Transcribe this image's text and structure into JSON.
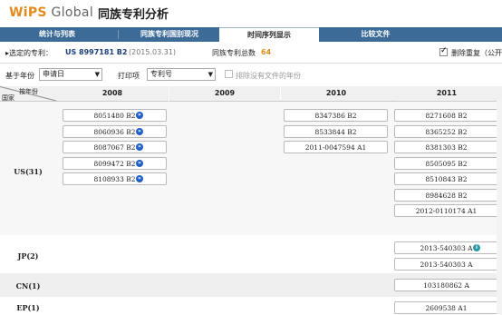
{
  "header": {
    "logo_prefix": "WiPS",
    "logo_suffix": " Global",
    "title": "同族专利分析"
  },
  "tabs": [
    {
      "label": "统计与列表"
    },
    {
      "label": "同族专利国别现况"
    },
    {
      "label": "时间序列显示"
    },
    {
      "label": "比较文件"
    }
  ],
  "active_tab": 2,
  "info": {
    "selected_label": "▸选定的专利：",
    "patent_number": "US 8997181 B2",
    "patent_date": "(2015.03.31)",
    "family_total_label": "同族专利总数",
    "family_total": "64",
    "dedupe_label": "删除重复（公开",
    "dedupe_checked": true
  },
  "filters": {
    "year_basis_label": "基于年份",
    "year_basis_value": "申请日",
    "print_label": "打印项",
    "print_value": "专利号",
    "exclude_label": "排除没有文件的年份"
  },
  "grid": {
    "corner_top": "按年份",
    "corner_bottom": "国家",
    "years": [
      "2008",
      "2009",
      "2010",
      "2011"
    ],
    "rows": [
      {
        "label": "US(31)",
        "cells": [
          [
            "8051480 B2",
            "8060936 B2",
            "8087067 B2",
            "8099472 B2",
            "8108933 B2"
          ],
          [],
          [
            "8347386 B2",
            "8533844 B2",
            "2011-0047594 A1"
          ],
          [
            "8271608 B2",
            "8365252 B2",
            "8381303 B2",
            "8505095 B2",
            "8510843 B2",
            "8984628 B2",
            "2012-0110174 A1"
          ]
        ]
      },
      {
        "label": "JP(2)",
        "cells": [
          [],
          [],
          [],
          [
            "2013-540303 A",
            "2013-540303 A"
          ]
        ]
      },
      {
        "label": "CN(1)",
        "cells": [
          [],
          [],
          [],
          [
            "103180862 A"
          ]
        ]
      },
      {
        "label": "EP(1)",
        "cells": [
          [],
          [],
          [],
          [
            "2609538 A1"
          ]
        ]
      }
    ]
  },
  "colors": {
    "tab_bar": "#3c6b98",
    "badge_blue": "#1f5fc8",
    "badge_teal": "#2a9aa8",
    "count_orange": "#e28a1b"
  }
}
